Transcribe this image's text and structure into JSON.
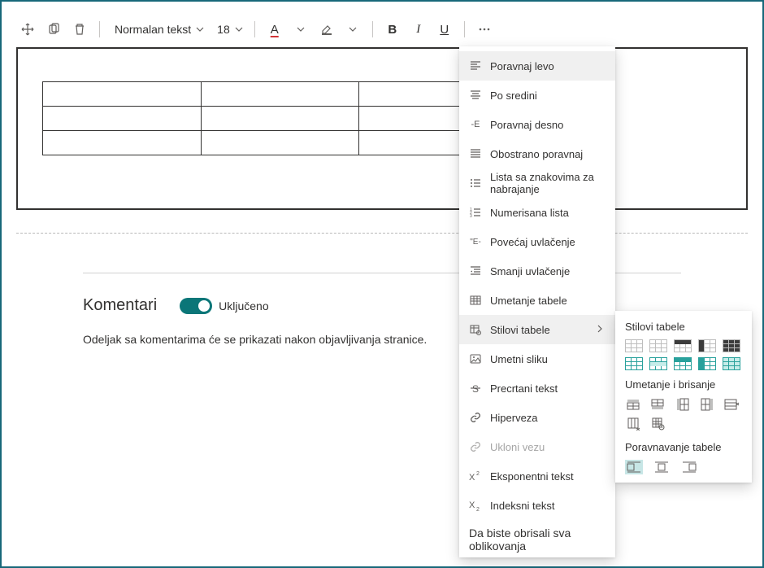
{
  "toolbar": {
    "text_style": "Normalan tekst",
    "font_size": "18"
  },
  "comments": {
    "title": "Komentari",
    "toggle_state": "Uključeno",
    "hint": "Odeljak sa komentarima će se prikazati nakon objavljivanja stranice."
  },
  "menu": {
    "items": {
      "align_left": "Poravnaj levo",
      "align_center": "Po sredini",
      "align_right": "Poravnaj desno",
      "justify": "Obostrano poravnaj",
      "bullet_list": "Lista sa znakovima za nabrajanje",
      "numbered_list": "Numerisana lista",
      "indent_increase": "Povećaj uvlačenje",
      "indent_decrease": "Smanji uvlačenje",
      "insert_table": "Umetanje tabele",
      "table_styles": "Stilovi tabele",
      "insert_image": "Umetni sliku",
      "strikethrough": "Precrtani tekst",
      "hyperlink": "Hiperveza",
      "remove_link": "Ukloni vezu",
      "superscript": "Eksponentni tekst",
      "subscript": "Indeksni tekst"
    },
    "footer": "Da biste obrisali sva oblikovanja"
  },
  "submenu": {
    "styles_title": "Stilovi tabele",
    "insert_delete_title": "Umetanje i brisanje",
    "align_title": "Poravnavanje tabele"
  }
}
